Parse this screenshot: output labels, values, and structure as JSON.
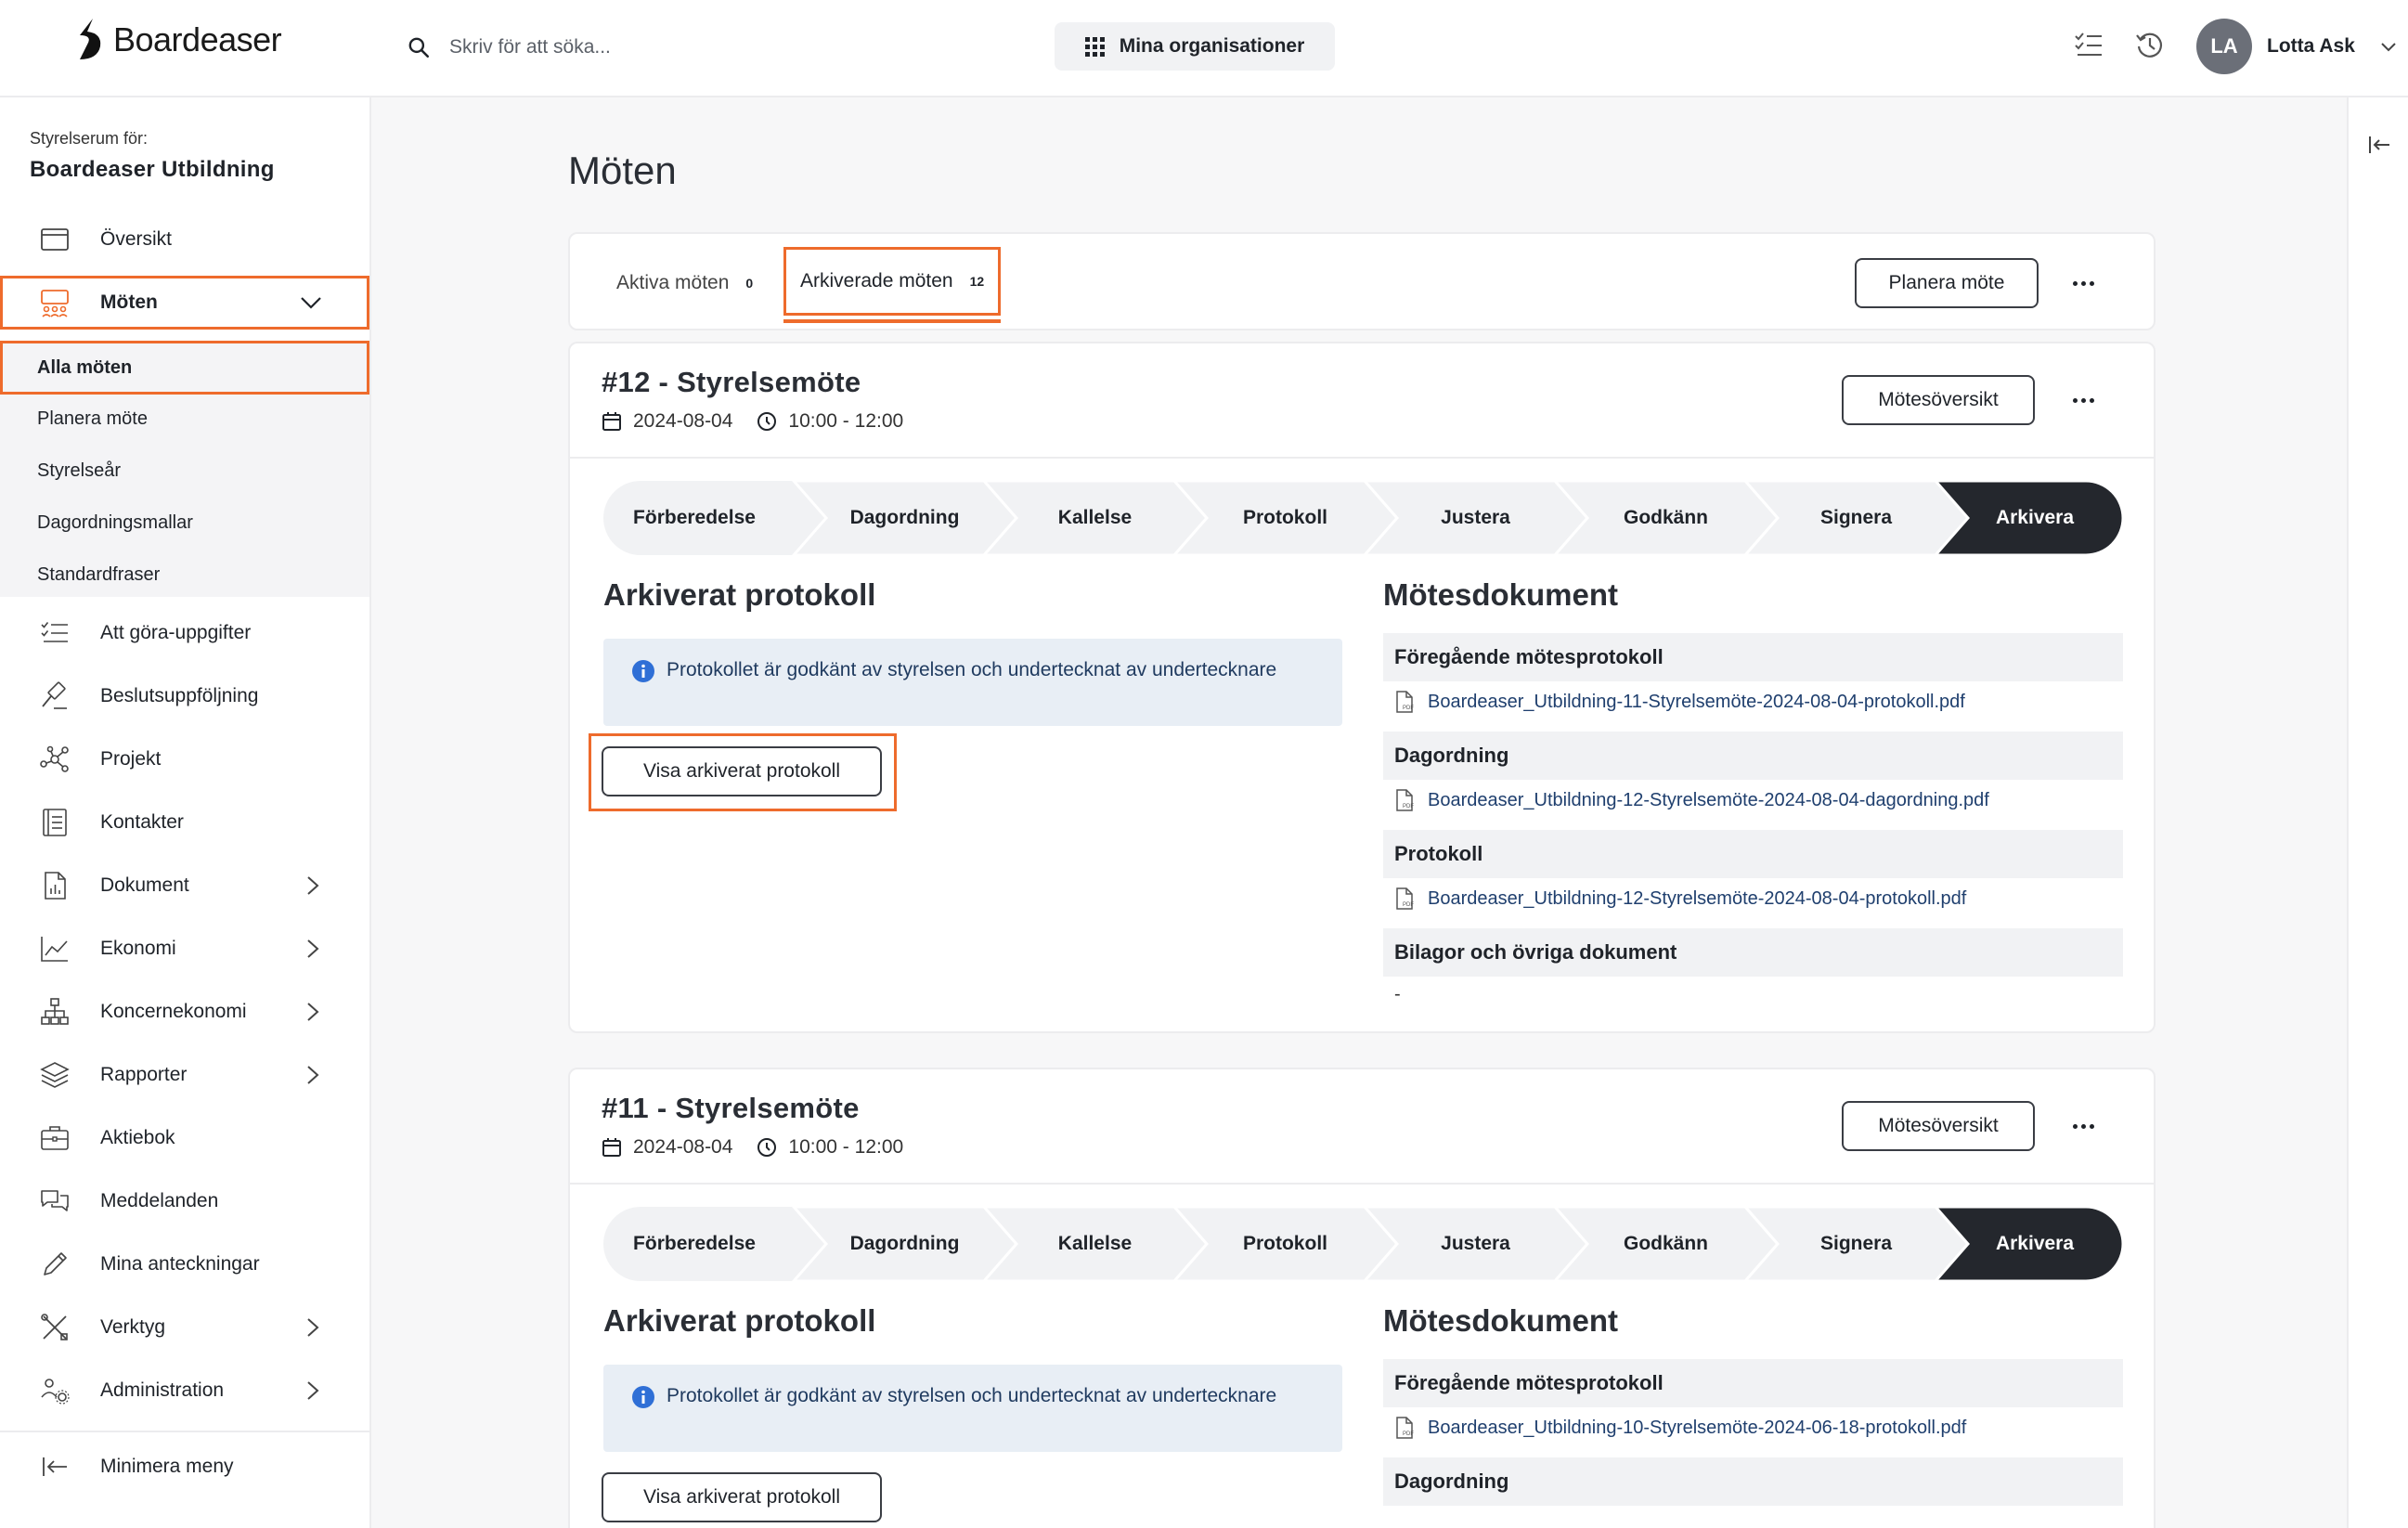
{
  "header": {
    "logo_text": "Boardeaser",
    "search_placeholder": "Skriv för att söka...",
    "org_button": "Mina organisationer",
    "user": {
      "initials": "LA",
      "name": "Lotta Ask"
    }
  },
  "sidebar": {
    "label": "Styrelserum för:",
    "org_name": "Boardeaser Utbildning",
    "overview": "Översikt",
    "meetings": "Möten",
    "sub_items": [
      "Alla möten",
      "Planera möte",
      "Styrelseår",
      "Dagordningsmallar",
      "Standardfraser"
    ],
    "items": [
      "Att göra-uppgifter",
      "Beslutsuppföljning",
      "Projekt",
      "Kontakter",
      "Dokument",
      "Ekonomi",
      "Koncernekonomi",
      "Rapporter",
      "Aktiebok",
      "Meddelanden",
      "Mina anteckningar",
      "Verktyg",
      "Administration"
    ],
    "minimize": "Minimera meny"
  },
  "main": {
    "title": "Möten",
    "tabs": [
      {
        "label": "Aktiva möten",
        "count": "0"
      },
      {
        "label": "Arkiverade möten",
        "count": "12"
      }
    ],
    "plan_button": "Planera möte",
    "meetings": [
      {
        "title": "#12 - Styrelsemöte",
        "date": "2024-08-04",
        "time": "10:00 - 12:00",
        "overview_button": "Mötesöversikt",
        "protocol_title": "Arkiverat protokoll",
        "info_text": "Protokollet är godkänt av styrelsen och undertecknat av undertecknare",
        "view_button": "Visa arkiverat protokoll",
        "docs_title": "Mötesdokument",
        "doc_sections": [
          {
            "title": "Föregående mötesprotokoll",
            "file": "Boardeaser_Utbildning-11-Styrelsemöte-2024-08-04-protokoll.pdf"
          },
          {
            "title": "Dagordning",
            "file": "Boardeaser_Utbildning-12-Styrelsemöte-2024-08-04-dagordning.pdf"
          },
          {
            "title": "Protokoll",
            "file": "Boardeaser_Utbildning-12-Styrelsemöte-2024-08-04-protokoll.pdf"
          },
          {
            "title": "Bilagor och övriga dokument",
            "file": "-"
          }
        ]
      },
      {
        "title": "#11 - Styrelsemöte",
        "date": "2024-08-04",
        "time": "10:00 - 12:00",
        "overview_button": "Mötesöversikt",
        "protocol_title": "Arkiverat protokoll",
        "info_text": "Protokollet är godkänt av styrelsen och undertecknat av undertecknare",
        "view_button": "Visa arkiverat protokoll",
        "docs_title": "Mötesdokument",
        "doc_sections": [
          {
            "title": "Föregående mötesprotokoll",
            "file": "Boardeaser_Utbildning-10-Styrelsemöte-2024-06-18-protokoll.pdf"
          },
          {
            "title": "Dagordning",
            "file": ""
          }
        ]
      }
    ],
    "steps": [
      "Förberedelse",
      "Dagordning",
      "Kallelse",
      "Protokoll",
      "Justera",
      "Godkänn",
      "Signera",
      "Arkivera"
    ]
  },
  "colors": {
    "highlight": "#ee6b2c",
    "step_dark": "#24272d",
    "step_light": "#f1f2f4",
    "link": "#1f3f6e",
    "info_bg": "#e8eef5",
    "info_icon": "#2f6fd6"
  }
}
